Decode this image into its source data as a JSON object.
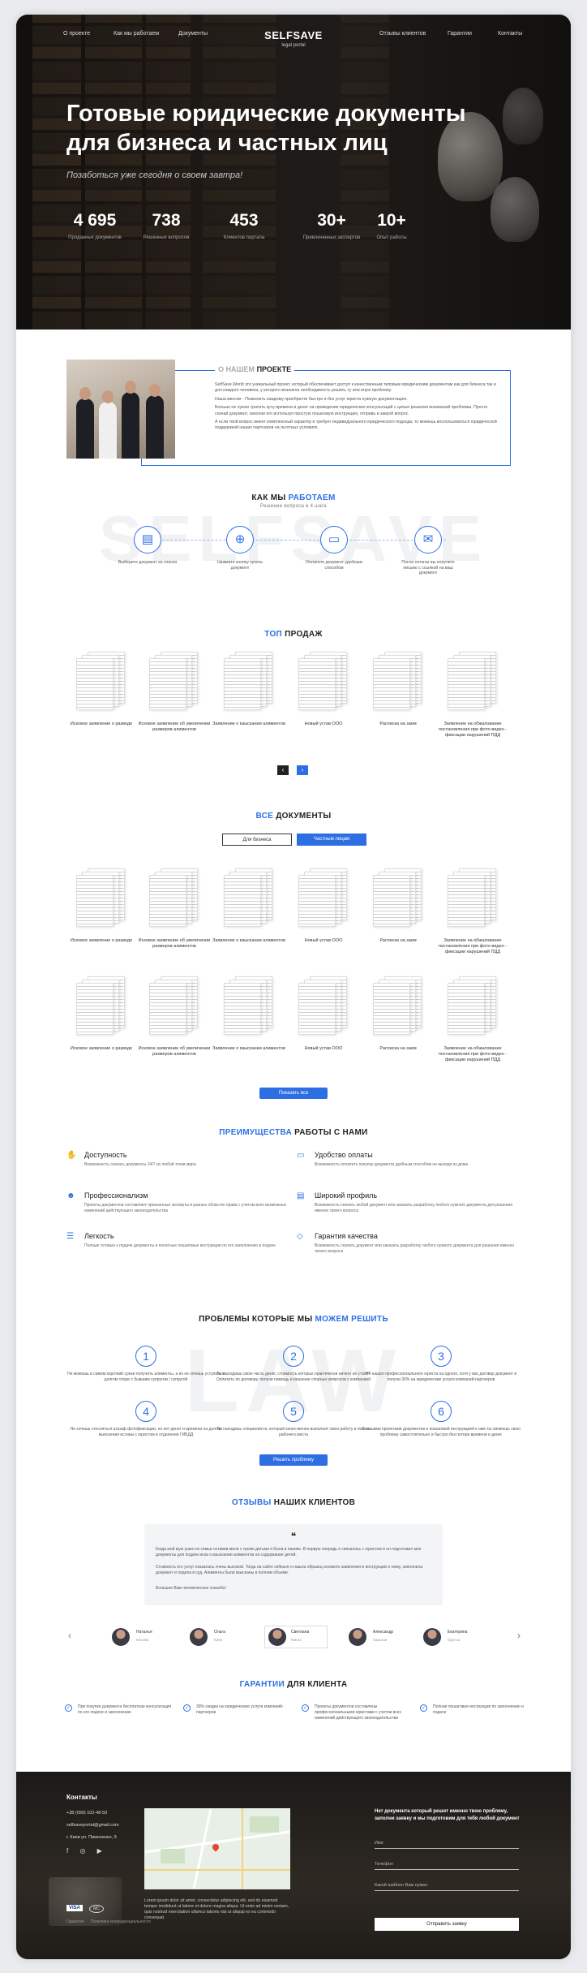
{
  "hero": {
    "nav": [
      "О проекте",
      "Как мы работаем",
      "Документы",
      "Отзывы клиентов",
      "Гарантии",
      "Контакты"
    ],
    "logo": "SELFSAVE",
    "logo_sub": "legal portal",
    "title": "Готовые юридические документы для бизнеса и частных лиц",
    "tagline": "Позаботься уже сегодня о своем завтра!",
    "stats": [
      {
        "value": "4 695",
        "label": "Проданных документов"
      },
      {
        "value": "738",
        "label": "Решенных вопросов"
      },
      {
        "value": "453",
        "label": "Клиентов портала"
      },
      {
        "value": "30+",
        "label": "Привлеченных экспертов"
      },
      {
        "value": "10+",
        "label": "Опыт работы"
      }
    ]
  },
  "about": {
    "title_grey": "О НАШЕМ",
    "title_dark": "ПРОЕКТЕ",
    "paragraphs": [
      "SelfSave.World это уникальный проект, который обеспечивает доступ к качественным типовым юридическим документам как для бизнеса так и для каждого человека, у которого возникла необходимость решить ту или иную проблему.",
      "Наша миссия - Позволить каждому приобрести быстро и без услуг юриста нужную документацию.",
      "Больше не нужно тратить кучу времени и денег на проведение юридических консультаций с целью решения возникшей проблемы. Просто скачай документ, заполни его используя простую пошаговую инструкцию, отправь и закрой вопрос.",
      "А если твой вопрос имеет комплексный характер и требует индивидуального юридического подхода, то можешь воспользоваться юридической поддержкой наших партнеров на льготных условиях."
    ]
  },
  "how": {
    "title_dark": "КАК МЫ",
    "title_blue": "РАБОТАЕМ",
    "subtitle": "Решение вопроса в 4 шага",
    "watermark": "SELFSAVE",
    "steps": [
      "Выберите документ из списка",
      "Нажмите кнопку купить документ",
      "Оплатите документ удобным способом",
      "После оплаты вы получите письмо с ссылкой на ваш документ"
    ]
  },
  "top": {
    "title_blue": "ТОП",
    "title_dark": "ПРОДАЖ",
    "items": [
      "Исковое заявление о разводе",
      "Исковое заявление об увеличении размеров алиментов",
      "Заявление о взыскании алиментов",
      "Новый устав ООО",
      "Расписка на заем",
      "Заявление на обжалование постановления при фото-видео - фиксации нарушений ПДД"
    ]
  },
  "all": {
    "title_blue": "ВСЕ",
    "title_dark": "ДОКУМЕНТЫ",
    "tabs": [
      "Для бизнеса",
      "Частным лицам"
    ],
    "rows": [
      [
        "Исковое заявление о разводе",
        "Исковое заявление об увеличении размеров алиментов",
        "Заявление о взыскании алиментов",
        "Новый устав ООО",
        "Расписка на заем",
        "Заявление на обжалование постановления при фото-видео - фиксации нарушений ПДД"
      ],
      [
        "Исковое заявление о разводе",
        "Исковое заявление об увеличении размеров алиментов",
        "Заявление о взыскании алиментов",
        "Новый устав ООО",
        "Расписка на заем",
        "Заявление на обжалование постановления при фото-видео - фиксации нарушений ПДД"
      ]
    ],
    "show_all": "Показать все"
  },
  "advantages": {
    "title_blue": "ПРЕИМУЩЕСТВА",
    "title_dark": "РАБОТЫ С НАМИ",
    "items": [
      {
        "title": "Доступность",
        "text": "Возможность скачать документы 24/7 из любой точки мира"
      },
      {
        "title": "Удобство оплаты",
        "text": "Возможность оплатить покупку документа удобным способом не выходя из дома"
      },
      {
        "title": "Профессионализм",
        "text": "Проекты документов составляют признанные эксперты в разных областях права с учетом всех возможных изменений действующего законодательства"
      },
      {
        "title": "Широкий профиль",
        "text": "Возможность скачать любой документ или заказать разработку любого нужного документа для решения именно твоего вопроса"
      },
      {
        "title": "Легкость",
        "text": "Полные готовые к подаче документы и понятные пошаговые инструкции по его заполнению и подаче"
      },
      {
        "title": "Гарантия качества",
        "text": "Возможность скачать документ или заказать разработку любого нужного документа для решения именно твоего вопроса"
      }
    ]
  },
  "problems": {
    "title_dark": "ПРОБЛЕМЫ КОТОРЫЕ МЫ",
    "title_blue": "МОЖЕМ РЕШИТЬ",
    "watermark": "LAW",
    "items": [
      {
        "n": "1",
        "text": "Не можешь в самом короткий сроки получить алименты, а их не хочешь уступать в долгом споре с бывшим супругом / супругой"
      },
      {
        "n": "2",
        "text": "Ты выходишь свою часть денег, стоимость которых практически ничего не стоит? Оплатить по договору, получи помощь и решение спорных вопросов с компанией"
      },
      {
        "n": "3",
        "text": "Не нашел профессионального юриста на одного, хотя у вас договор документ и получи 30% на юридические услуги компаний-партнеров"
      },
      {
        "n": "4",
        "text": "Не хочешь стесняться штраф фотофиксации, но нет денег и времени на долгие выяснения истины с юристом в отделении ГИБДД"
      },
      {
        "n": "5",
        "text": "Ты находишь специалиста, который качественно выполнит свою работу в поиске рабочего места"
      },
      {
        "n": "6",
        "text": "С нашими проектами документов и пошаговой инструкцией к ним ты сможешь свою проблему самостоятельно и быстро без потери времени и денег"
      }
    ],
    "button": "Решить проблему"
  },
  "reviews": {
    "title_blue": "ОТЗЫВЫ",
    "title_dark": "НАШИХ КЛИЕНТОВ",
    "quote_mark": "❝",
    "paragraphs": [
      "Когда мой муж ушел из семьи оставив меня с тремя детьми я была в панике. В первую очередь я связалась с юристом и он подготовил мне документы для подачи иска о взыскании алиментов на содержание детей.",
      "Cтоимость его услуг оказалась очень высокой. Тогда на сайте selfsave я нашла образец искового заявления и инструкцию к нему, заполнила документ и подала в суд. Алименты были взысканы в полном объеме.",
      "Большое Вам человеческое спасибо!"
    ],
    "people": [
      {
        "name": "Наталья",
        "city": "Москва"
      },
      {
        "name": "Ольга",
        "city": "Киев"
      },
      {
        "name": "Светлана",
        "city": "Минск"
      },
      {
        "name": "Александр",
        "city": "Харьков"
      },
      {
        "name": "Екатерина",
        "city": "Одесса"
      }
    ],
    "prev": "‹",
    "next": "›"
  },
  "guarantees": {
    "title_blue": "ГАРАНТИИ",
    "title_dark": "ДЛЯ КЛИЕНТА",
    "items": [
      "При покупке документа бесплатная консультация по его подаче и заполнению",
      "30% скидка на юридические услуги компаний-партнеров",
      "Проекты документов составлены профессиональными юристами с учетом всех изменений действующего законодательства",
      "Полная пошаговая инструкция по заполнению и подаче"
    ]
  },
  "footer": {
    "contacts_title": "Контакты",
    "phone": "+38 (099) 102-48-50",
    "email": "selfsaveportal@gmail.com",
    "address": "г. Киев ул. Пимоненко, 9",
    "about_text": "Lorem ipsum dolor sit amet, consectetur adipiscing elit, sed do eiusmod tempor incididunt ut labore et dolore magna aliqua. Ut enim ad minim veniam, quis nostrud exercitation ullamco laboris nisi ut aliquip ex ea commodo consequat.",
    "links": [
      "Гарантия",
      "Политика конфиденциальности"
    ],
    "form_title": "Нет документа который решит именно твою проблему, заполни заявку и мы подготовим для тебя любой документ",
    "form_fields": [
      "Имя",
      "Телефон",
      "Какой шаблон Вам нужен"
    ],
    "submit": "Отправить заявку",
    "payments": [
      "VISA",
      "MC"
    ]
  }
}
